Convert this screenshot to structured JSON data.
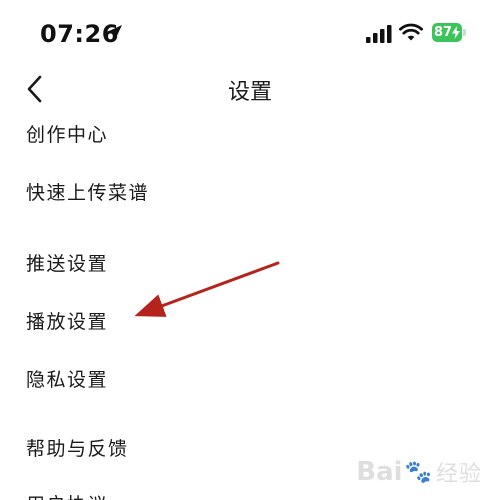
{
  "status_bar": {
    "time": "07:26",
    "battery": "87"
  },
  "nav": {
    "title": "设置"
  },
  "menu": {
    "items": [
      {
        "label": "创作中心"
      },
      {
        "label": "快速上传菜谱"
      },
      {
        "label": "推送设置"
      },
      {
        "label": "播放设置"
      },
      {
        "label": "隐私设置"
      },
      {
        "label": "帮助与反馈"
      },
      {
        "label": "用户协议"
      }
    ]
  },
  "watermark": {
    "text": "Bai",
    "paw": "🐾",
    "sub": "经验"
  },
  "colors": {
    "battery": "#3cc45b",
    "arrow": "#b5241c",
    "text": "#1a1a1a"
  },
  "icons": {
    "location": "location-arrow-icon",
    "signal": "cellular-signal-icon",
    "wifi": "wifi-icon",
    "battery": "battery-charging-icon",
    "back": "chevron-left-icon"
  }
}
